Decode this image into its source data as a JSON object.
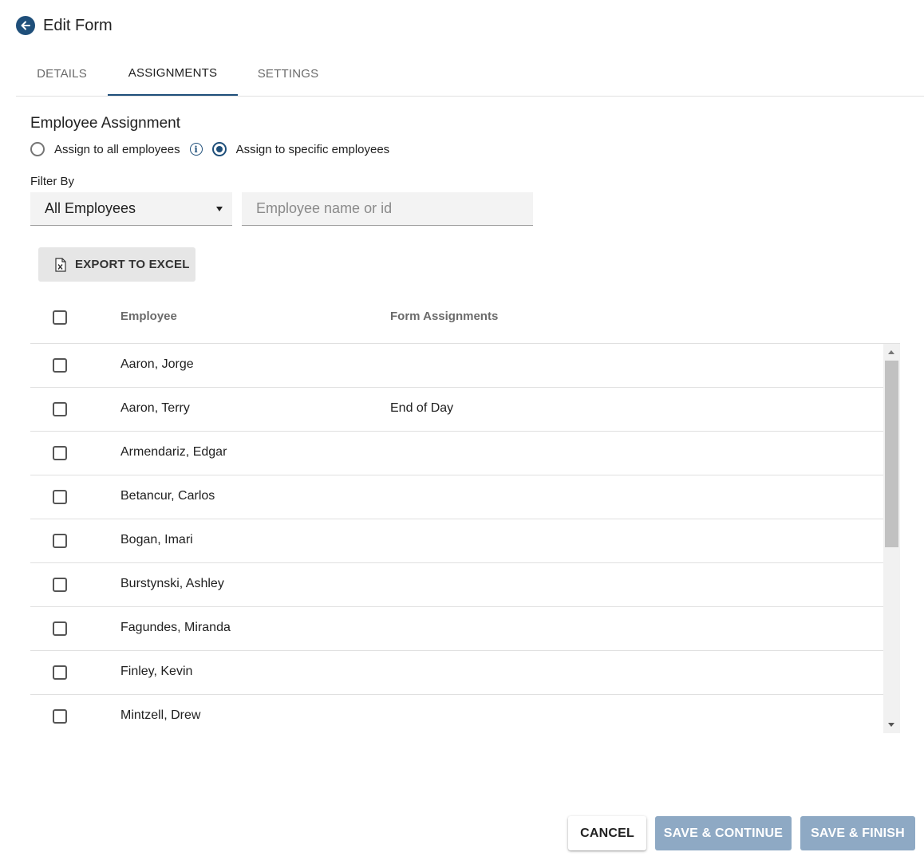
{
  "header": {
    "title": "Edit Form",
    "back_icon": "arrow-left-icon"
  },
  "tabs": [
    {
      "label": "DETAILS",
      "active": false
    },
    {
      "label": "ASSIGNMENTS",
      "active": true
    },
    {
      "label": "SETTINGS",
      "active": false
    }
  ],
  "assignment": {
    "title": "Employee Assignment",
    "option_all": "Assign to all employees",
    "option_specific": "Assign to specific employees",
    "selected": "specific"
  },
  "filter": {
    "label": "Filter By",
    "selected": "All Employees",
    "search_placeholder": "Employee name or id",
    "search_value": ""
  },
  "export": {
    "label": "EXPORT TO EXCEL",
    "icon": "excel-file-icon"
  },
  "table": {
    "columns": [
      "Employee",
      "Form Assignments"
    ],
    "rows": [
      {
        "employee": "Aaron, Jorge",
        "assignments": ""
      },
      {
        "employee": "Aaron, Terry",
        "assignments": "End of Day"
      },
      {
        "employee": "Armendariz, Edgar",
        "assignments": ""
      },
      {
        "employee": "Betancur, Carlos",
        "assignments": ""
      },
      {
        "employee": "Bogan, Imari",
        "assignments": ""
      },
      {
        "employee": "Burstynski, Ashley",
        "assignments": ""
      },
      {
        "employee": "Fagundes, Miranda",
        "assignments": ""
      },
      {
        "employee": "Finley, Kevin",
        "assignments": ""
      },
      {
        "employee": "Mintzell, Drew",
        "assignments": ""
      }
    ]
  },
  "footer": {
    "cancel": "CANCEL",
    "save_continue": "SAVE & CONTINUE",
    "save_finish": "SAVE & FINISH"
  },
  "colors": {
    "primary": "#1f4f7a",
    "disabled_button": "#8ea9c4"
  }
}
